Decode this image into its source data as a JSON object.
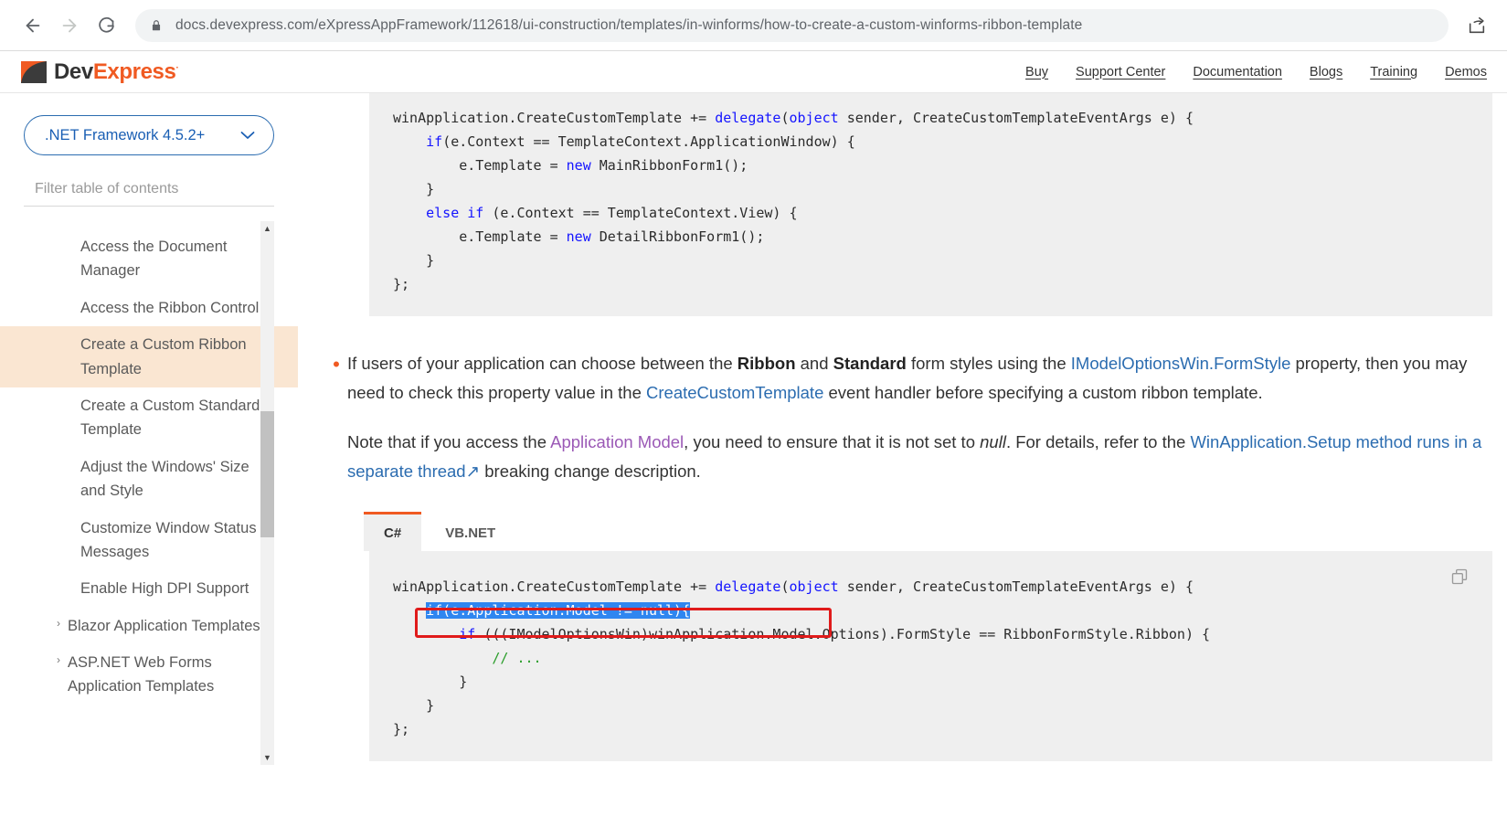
{
  "browser": {
    "url": "docs.devexpress.com/eXpressAppFramework/112618/ui-construction/templates/in-winforms/how-to-create-a-custom-winforms-ribbon-template",
    "back_label": "Back",
    "forward_label": "Forward",
    "reload_label": "Reload",
    "share_label": "Share"
  },
  "site_header": {
    "logo_dev": "Dev",
    "logo_express": "Express",
    "logo_registered": "·",
    "nav": [
      {
        "label": "Buy"
      },
      {
        "label": "Support Center"
      },
      {
        "label": "Documentation"
      },
      {
        "label": "Blogs"
      },
      {
        "label": "Training"
      },
      {
        "label": "Demos"
      }
    ]
  },
  "sidebar": {
    "framework_select": {
      "value": ".NET Framework 4.5.2+",
      "chevron": "⌄"
    },
    "filter": {
      "placeholder": "Filter table of contents",
      "value": ""
    },
    "toc": [
      {
        "label": "Access the Document Manager",
        "active": false,
        "expandable": false
      },
      {
        "label": "Access the Ribbon Control",
        "active": false,
        "expandable": false
      },
      {
        "label": "Create a Custom Ribbon Template",
        "active": true,
        "expandable": false
      },
      {
        "label": "Create a Custom Standard Template",
        "active": false,
        "expandable": false
      },
      {
        "label": "Adjust the Windows' Size and Style",
        "active": false,
        "expandable": false
      },
      {
        "label": "Customize Window Status Messages",
        "active": false,
        "expandable": false
      },
      {
        "label": "Enable High DPI Support",
        "active": false,
        "expandable": false
      },
      {
        "label": "Blazor Application Templates",
        "active": false,
        "expandable": true,
        "caret": "›"
      },
      {
        "label": "ASP.NET Web Forms Application Templates",
        "active": false,
        "expandable": true,
        "caret": "›"
      }
    ],
    "scrollbar": {
      "up_arrow": "▲",
      "down_arrow": "▼"
    }
  },
  "content": {
    "code_block_1": {
      "line1_a": "winApplication.CreateCustomTemplate += ",
      "line1_kw1": "delegate",
      "line1_b": "(",
      "line1_kw2": "object",
      "line1_c": " sender, CreateCustomTemplateEventArgs e) {",
      "line2_kw": "if",
      "line2_rest": "(e.Context == TemplateContext.ApplicationWindow) {",
      "line3_a": "e.Template = ",
      "line3_kw": "new",
      "line3_b": " MainRibbonForm1();",
      "line4": "}",
      "line5_kw1": "else",
      "line5_kw2": "if",
      "line5_rest": " (e.Context == TemplateContext.View) {",
      "line6_a": "e.Template = ",
      "line6_kw": "new",
      "line6_b": " DetailRibbonForm1();",
      "line7": "}",
      "line8": "};"
    },
    "bullet": {
      "t1": "If users of your application can choose between the ",
      "b1": "Ribbon",
      "t2": " and ",
      "b2": "Standard",
      "t3": " form styles using the ",
      "link1": "IModelOptionsWin.FormStyle",
      "t4": " property, then you may need to check this property value in the ",
      "link2": "CreateCustomTemplate",
      "t5": " event handler before specifying a custom ribbon template.",
      "note_t1": "Note that if you access the ",
      "note_link": "Application Model",
      "note_t2": ", you need to ensure that it is not set to ",
      "note_i": "null",
      "note_t3": ". For details, refer to the ",
      "note_link2": "WinApplication.Setup method runs in a separate thread",
      "note_link2_icon": "↗",
      "note_t4": " breaking change description."
    },
    "tabs": [
      {
        "label": "C#",
        "active": true
      },
      {
        "label": "VB.NET",
        "active": false
      }
    ],
    "code_block_2": {
      "line1_a": "winApplication.CreateCustomTemplate += ",
      "line1_kw1": "delegate",
      "line1_b": "(",
      "line1_kw2": "object",
      "line1_c": " sender, CreateCustomTemplateEventArgs e) {",
      "line2_selected": "if(e.Application.Model != null){",
      "line3_kw": "if",
      "line3_rest": " (((IModelOptionsWin)winApplication.Model.Options).FormStyle == RibbonFormStyle.Ribbon) {",
      "line4_comment": "// ...",
      "line5": "}",
      "line6": "}",
      "line7": "};",
      "copy_label": "Copy"
    }
  },
  "colors": {
    "accent_orange": "#f05a22",
    "link_blue": "#2b6cb0",
    "visited_purple": "#9b59b6",
    "active_toc_bg": "#fae6d2",
    "code_bg": "#efefef",
    "selection_blue": "#2f86f0",
    "highlight_red": "#e01b1b",
    "keyword_blue": "#1414ff",
    "comment_green": "#2a9d2a"
  }
}
